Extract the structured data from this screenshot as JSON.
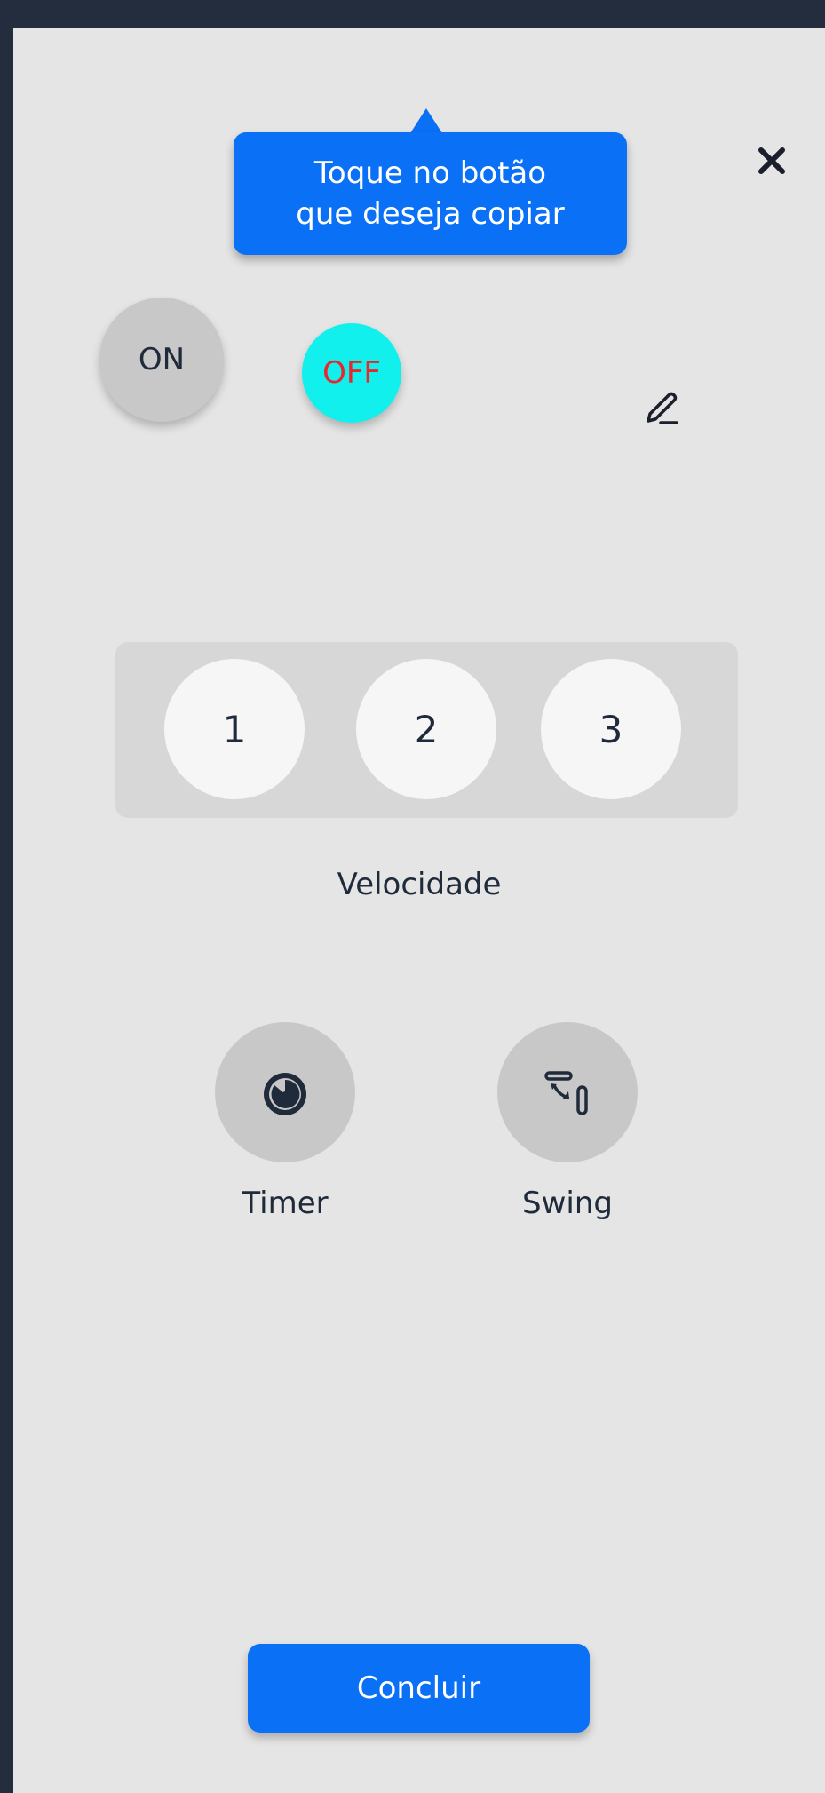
{
  "tooltip": {
    "line1": "Toque no botão",
    "line2": "que deseja copiar"
  },
  "icons": {
    "close": "close-icon",
    "edit": "pencil-icon",
    "timer": "timer-icon",
    "swing": "swing-icon"
  },
  "power": {
    "on_label": "ON",
    "off_label": "OFF"
  },
  "speed": {
    "buttons": [
      "1",
      "2",
      "3"
    ],
    "label": "Velocidade"
  },
  "controls": {
    "timer_label": "Timer",
    "swing_label": "Swing"
  },
  "footer": {
    "concluir_label": "Concluir"
  },
  "colors": {
    "accent": "#0a70f5",
    "off_button_bg": "#12f0ee",
    "off_button_text": "#e8262c",
    "background": "#e5e5e5",
    "frame": "#232d3d"
  }
}
